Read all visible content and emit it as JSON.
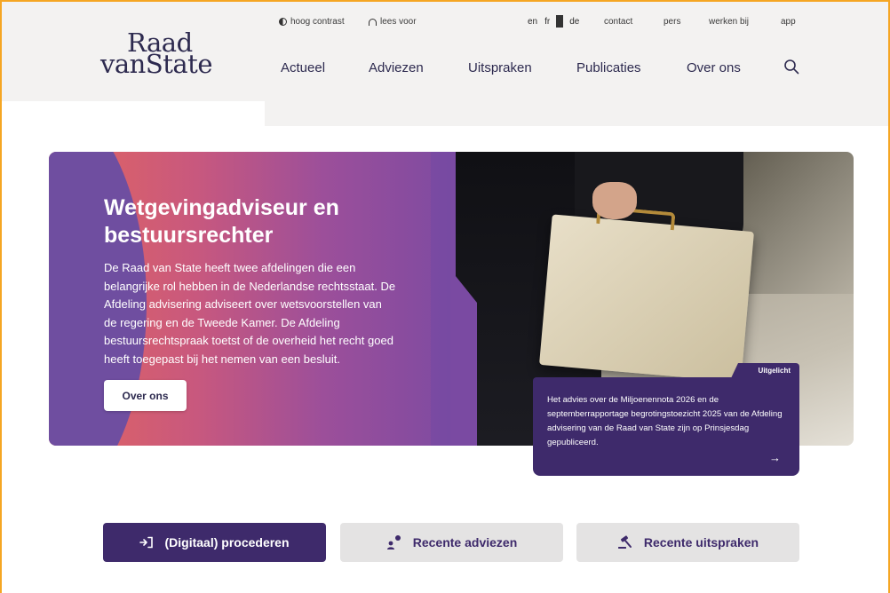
{
  "logo": {
    "line1": "Raad",
    "line2": "vanState"
  },
  "utility": {
    "high_contrast": "hoog contrast",
    "read_aloud": "lees voor",
    "languages": [
      "en",
      "fr",
      "de"
    ],
    "links": [
      "contact",
      "pers",
      "werken bij",
      "app"
    ]
  },
  "nav": {
    "items": [
      "Actueel",
      "Adviezen",
      "Uitspraken",
      "Publicaties",
      "Over ons"
    ]
  },
  "hero": {
    "title": "Wetgevingadviseur en bestuursrechter",
    "text": "De Raad van State heeft twee afdelingen die een belangrijke rol hebben in de Nederlandse rechtsstaat. De Afdeling advisering adviseert over wetsvoorstellen van de regering en de Tweede Kamer. De Afdeling bestuursrechtspraak toetst of de overheid het recht goed heeft toegepast bij het nemen van een besluit.",
    "button": "Over ons"
  },
  "highlight": {
    "tag": "Uitgelicht",
    "text": "Het advies over de Miljoenennota 2026 en de septemberrapportage begrotingstoezicht 2025 van de Afdeling advisering van de Raad van State zijn op Prinsjesdag gepubliceerd.",
    "arrow": "→"
  },
  "actions": {
    "procederen": "(Digitaal) procederen",
    "adviezen": "Recente adviezen",
    "uitspraken": "Recente uitspraken"
  },
  "colors": {
    "brand_purple": "#3e2a6b",
    "gradient_start": "#e4665e",
    "gradient_end": "#7a4aa2",
    "header_bg": "#f3f2f1"
  }
}
